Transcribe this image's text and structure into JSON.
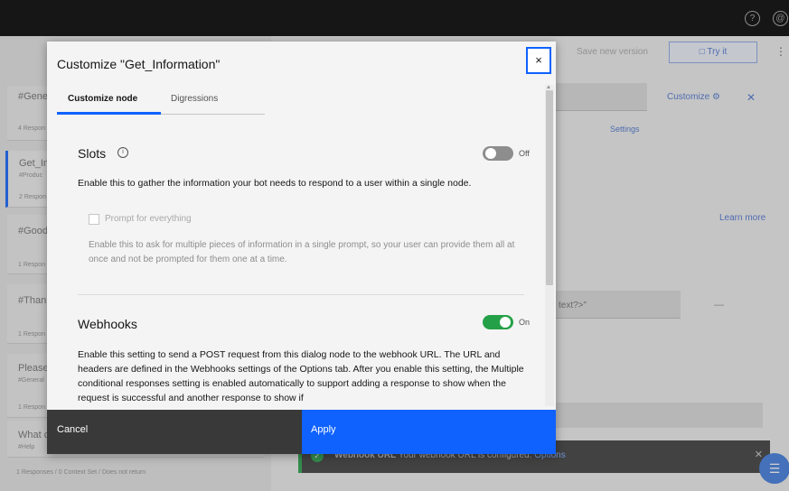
{
  "background": {
    "nodes": [
      {
        "title": "#Gene",
        "meta": "4 Respon",
        "sub": ""
      },
      {
        "title": "Get_In",
        "sub": "#Produc",
        "meta": "2 Respon"
      },
      {
        "title": "#Good",
        "sub": "",
        "meta": "1 Respon"
      },
      {
        "title": "#Thank",
        "sub": "",
        "meta": "1 Respon"
      },
      {
        "title": "Please",
        "sub": "#General",
        "meta": "1 Respon"
      },
      {
        "title": "What c",
        "sub": "#Help",
        "meta": ""
      }
    ],
    "left_footer": "1 Responses / 0 Context Set / Does not return",
    "save_version": "Save new version",
    "try_it": "Try it",
    "customize": "Customize",
    "settings": "Settings",
    "learn_more": "Learn more",
    "context_text": "text?>\"",
    "minus": "—",
    "toast_title": "Webhook URL",
    "toast_text": "Your webhook URL is configured.",
    "toast_link": "Options"
  },
  "modal": {
    "title": "Customize \"Get_Information\"",
    "close": "×",
    "tabs": [
      {
        "label": "Customize node",
        "active": true
      },
      {
        "label": "Digressions",
        "active": false
      }
    ],
    "slots": {
      "title": "Slots",
      "info": "i",
      "toggle_label": "Off",
      "enabled": false,
      "description": "Enable this to gather the information your bot needs to respond to a user within a single node.",
      "prompt_label": "Prompt for everything",
      "prompt_description": "Enable this to ask for multiple pieces of information in a single prompt, so your user can provide them all at once and not be prompted for them one at a time."
    },
    "webhooks": {
      "title": "Webhooks",
      "toggle_label": "On",
      "enabled": true,
      "description": "Enable this setting to send a POST request from this dialog node to the webhook URL. The URL and headers are defined in the Webhooks settings of the Options tab. After you enable this setting, the Multiple conditional responses setting is enabled automatically to support adding a response to show when the request is successful and another response to show if"
    },
    "footer": {
      "cancel": "Cancel",
      "apply": "Apply"
    }
  },
  "colors": {
    "primary": "#0f62fe",
    "toggle_on": "#24a148",
    "toggle_off": "#8d8d8d"
  }
}
